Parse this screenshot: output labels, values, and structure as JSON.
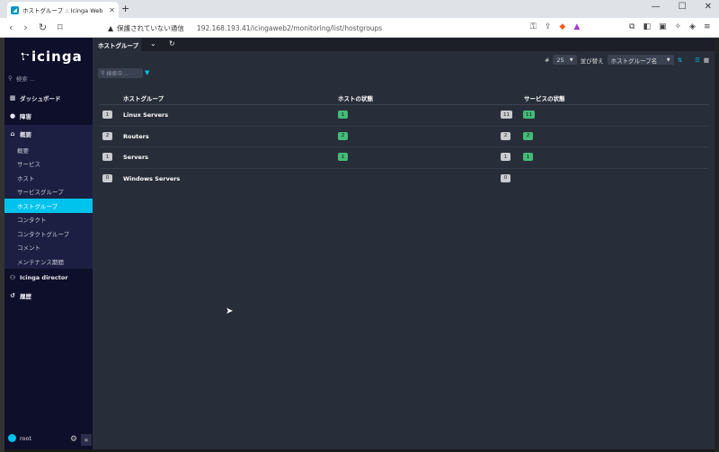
{
  "browser": {
    "tab_title": "ホストグループ :: Icinga Web",
    "new_tab": "+",
    "security_text": "保護されていない通信",
    "url": "192.168.193.41/icingaweb2/monitoring/list/hostgroups"
  },
  "sidebar": {
    "logo": "icinga",
    "search_placeholder": "検索 ...",
    "items": [
      {
        "label": "ダッシュボード",
        "icon": "dashboard-icon"
      },
      {
        "label": "障害",
        "icon": "problems-icon"
      },
      {
        "label": "概要",
        "icon": "overview-icon"
      }
    ],
    "sub_items": [
      {
        "label": "概要"
      },
      {
        "label": "サービス"
      },
      {
        "label": "ホスト"
      },
      {
        "label": "サービスグループ"
      },
      {
        "label": "ホストグループ"
      },
      {
        "label": "コンタクト"
      },
      {
        "label": "コンタクトグループ"
      },
      {
        "label": "コメント"
      },
      {
        "label": "メンテナンス期間"
      }
    ],
    "after_items": [
      {
        "label": "Icinga director",
        "icon": "director-icon"
      },
      {
        "label": "履歴",
        "icon": "history-icon"
      }
    ],
    "user": "root"
  },
  "main": {
    "tab_label": "ホストグループ",
    "controls": {
      "limit_label": "#",
      "limit_value": "25",
      "sort_label": "並び替え",
      "sort_value": "ホストグループ名"
    },
    "filter_placeholder": "検索中...",
    "table": {
      "headers": [
        "ホストグループ",
        "ホストの状態",
        "サービスの状態"
      ],
      "rows": [
        {
          "count": "1",
          "name": "Linux Servers",
          "host_ok": "1",
          "service_total": "11",
          "service_ok": "11"
        },
        {
          "count": "2",
          "name": "Routers",
          "host_ok": "2",
          "service_total": "2",
          "service_ok": "2"
        },
        {
          "count": "1",
          "name": "Servers",
          "host_ok": "1",
          "service_total": "1",
          "service_ok": "1"
        },
        {
          "count": "0",
          "name": "Windows Servers",
          "host_ok": "",
          "service_total": "0",
          "service_ok": ""
        }
      ]
    }
  },
  "colors": {
    "accent": "#00c3ed",
    "ok": "#44bb77",
    "sidebar_bg": "#0e0f2a",
    "main_bg": "#282e39"
  }
}
